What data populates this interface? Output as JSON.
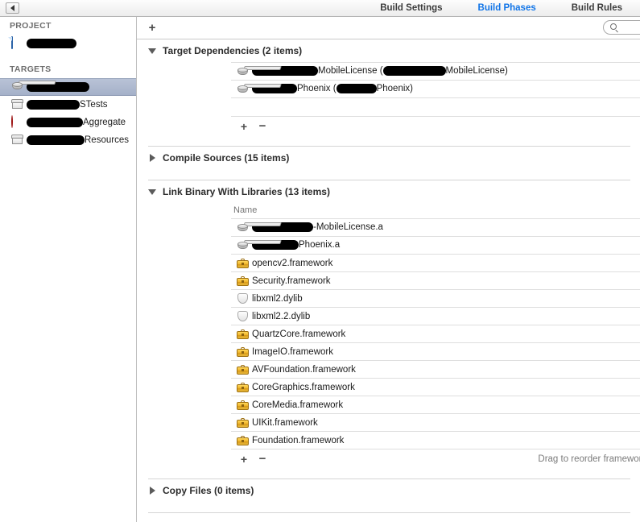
{
  "window": {
    "back_button": "back-arrow",
    "tabs": [
      {
        "label": "Build Settings",
        "active": false
      },
      {
        "label": "Build Phases",
        "active": true
      },
      {
        "label": "Build Rules",
        "active": false
      }
    ],
    "accent_color": "#1175e8"
  },
  "sidebar": {
    "groups": [
      {
        "header": "PROJECT",
        "items": [
          {
            "icon": "xcode-project-icon",
            "redacted_prefix_width": 62,
            "label": "",
            "selected": false
          }
        ]
      },
      {
        "header": "TARGETS",
        "items": [
          {
            "icon": "static-library-icon",
            "redacted_prefix_width": 78,
            "label": "",
            "selected": true
          },
          {
            "icon": "test-bundle-icon",
            "redacted_prefix_width": 66,
            "label": "STests",
            "selected": false
          },
          {
            "icon": "aggregate-target-icon",
            "redacted_prefix_width": 70,
            "label": "Aggregate",
            "selected": false
          },
          {
            "icon": "resource-bundle-icon",
            "redacted_prefix_width": 72,
            "label": "Resources",
            "selected": false
          }
        ]
      }
    ]
  },
  "toolbar": {
    "add_phase_label": "+",
    "search_placeholder": "",
    "search_value": "",
    "search_icon": "search-icon"
  },
  "phases": [
    {
      "name": "target-dependencies",
      "title": "Target Dependencies (2 items)",
      "expanded": true,
      "has_column_header": false,
      "column_header": "",
      "rows": [
        {
          "icon": "static-library-icon",
          "redacted_prefix_width": 82,
          "text": "MobileLicense (",
          "redacted_mid_width": 78,
          "text_after": "MobileLicense)"
        },
        {
          "icon": "static-library-icon",
          "redacted_prefix_width": 56,
          "text": "Phoenix (",
          "redacted_mid_width": 50,
          "text_after": "Phoenix)"
        }
      ],
      "has_empty_strip": true,
      "footer": {
        "add": "+",
        "remove": "−",
        "hint": ""
      }
    },
    {
      "name": "compile-sources",
      "title": "Compile Sources (15 items)",
      "expanded": false,
      "rows": []
    },
    {
      "name": "link-binary-with-libraries",
      "title": "Link Binary With Libraries (13 items)",
      "expanded": true,
      "has_column_header": true,
      "column_header": "Name",
      "rows": [
        {
          "icon": "static-library-icon",
          "redacted_prefix_width": 76,
          "text": "-MobileLicense.a"
        },
        {
          "icon": "static-library-icon",
          "redacted_prefix_width": 58,
          "text": "Phoenix.a"
        },
        {
          "icon": "framework-icon",
          "text": "opencv2.framework"
        },
        {
          "icon": "framework-icon",
          "text": "Security.framework"
        },
        {
          "icon": "dylib-icon",
          "text": "libxml2.dylib"
        },
        {
          "icon": "dylib-icon",
          "text": "libxml2.2.dylib"
        },
        {
          "icon": "framework-icon",
          "text": "QuartzCore.framework"
        },
        {
          "icon": "framework-icon",
          "text": "ImageIO.framework"
        },
        {
          "icon": "framework-icon",
          "text": "AVFoundation.framework"
        },
        {
          "icon": "framework-icon",
          "text": "CoreGraphics.framework"
        },
        {
          "icon": "framework-icon",
          "text": "CoreMedia.framework"
        },
        {
          "icon": "framework-icon",
          "text": "UIKit.framework"
        },
        {
          "icon": "framework-icon",
          "text": "Foundation.framework"
        }
      ],
      "has_empty_strip": false,
      "footer": {
        "add": "+",
        "remove": "−",
        "hint": "Drag to reorder frameworks"
      }
    },
    {
      "name": "copy-files",
      "title": "Copy Files (0 items)",
      "expanded": false,
      "rows": []
    }
  ]
}
